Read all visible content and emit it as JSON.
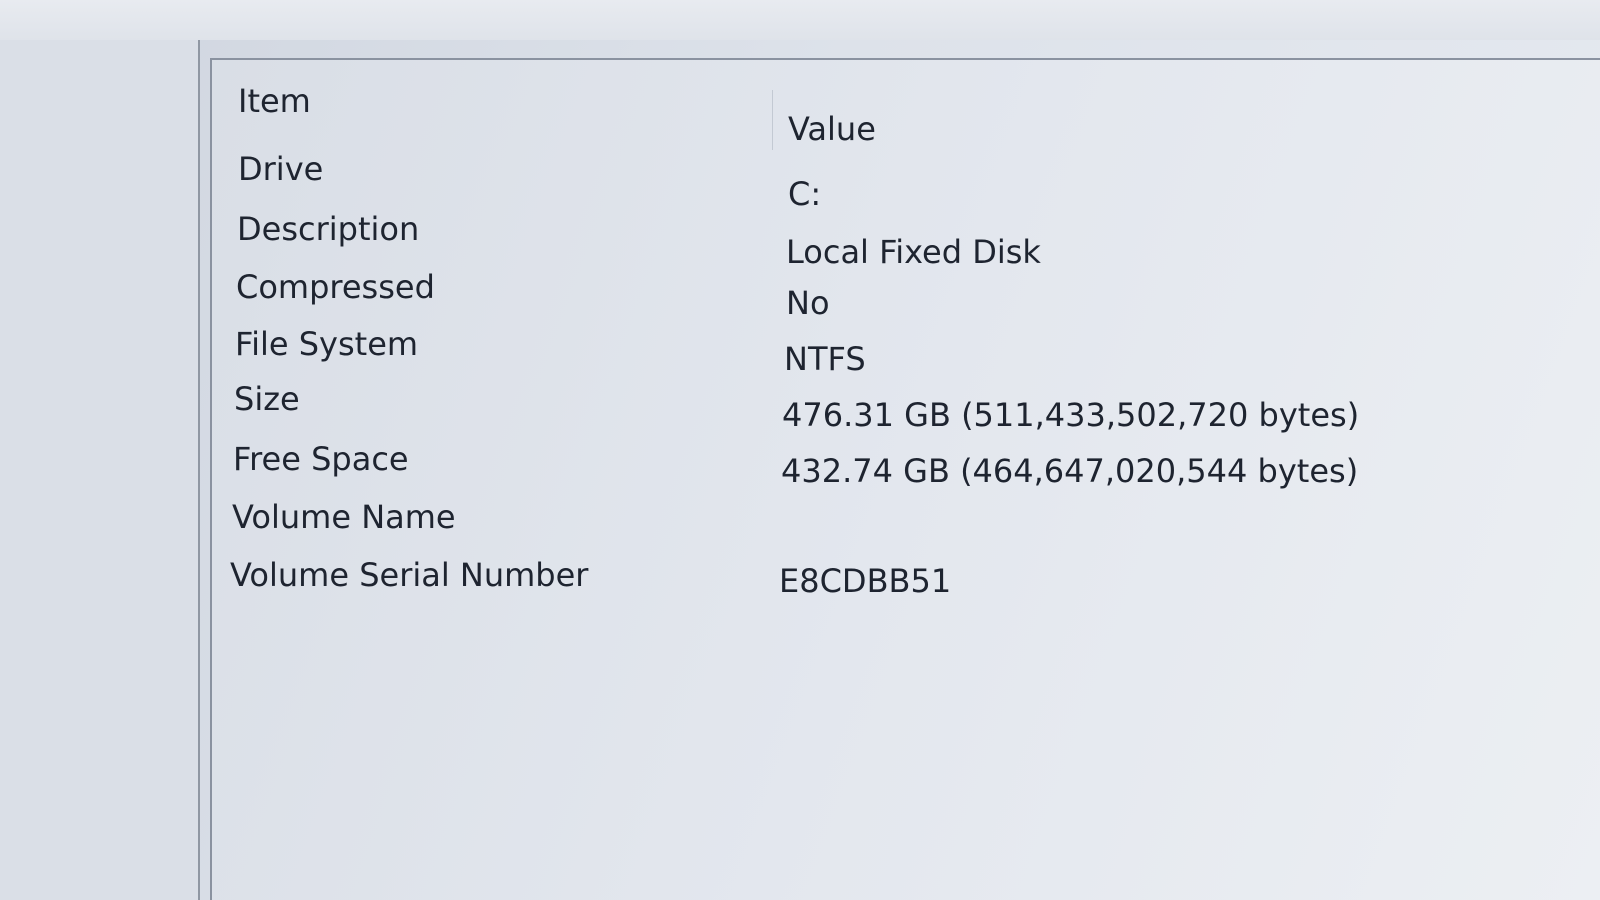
{
  "list": {
    "columns": [
      "Item",
      "Value"
    ],
    "rows": [
      {
        "item": "Drive",
        "value": "C:"
      },
      {
        "item": "Description",
        "value": "Local Fixed Disk"
      },
      {
        "item": "Compressed",
        "value": "No"
      },
      {
        "item": "File System",
        "value": "NTFS"
      },
      {
        "item": "Size",
        "value": "476.31 GB (511,433,502,720 bytes)"
      },
      {
        "item": "Free Space",
        "value": "432.74 GB (464,647,020,544 bytes)"
      },
      {
        "item": "Volume Name",
        "value": ""
      },
      {
        "item": "Volume Serial Number",
        "value": "E8CDBB51"
      }
    ]
  }
}
